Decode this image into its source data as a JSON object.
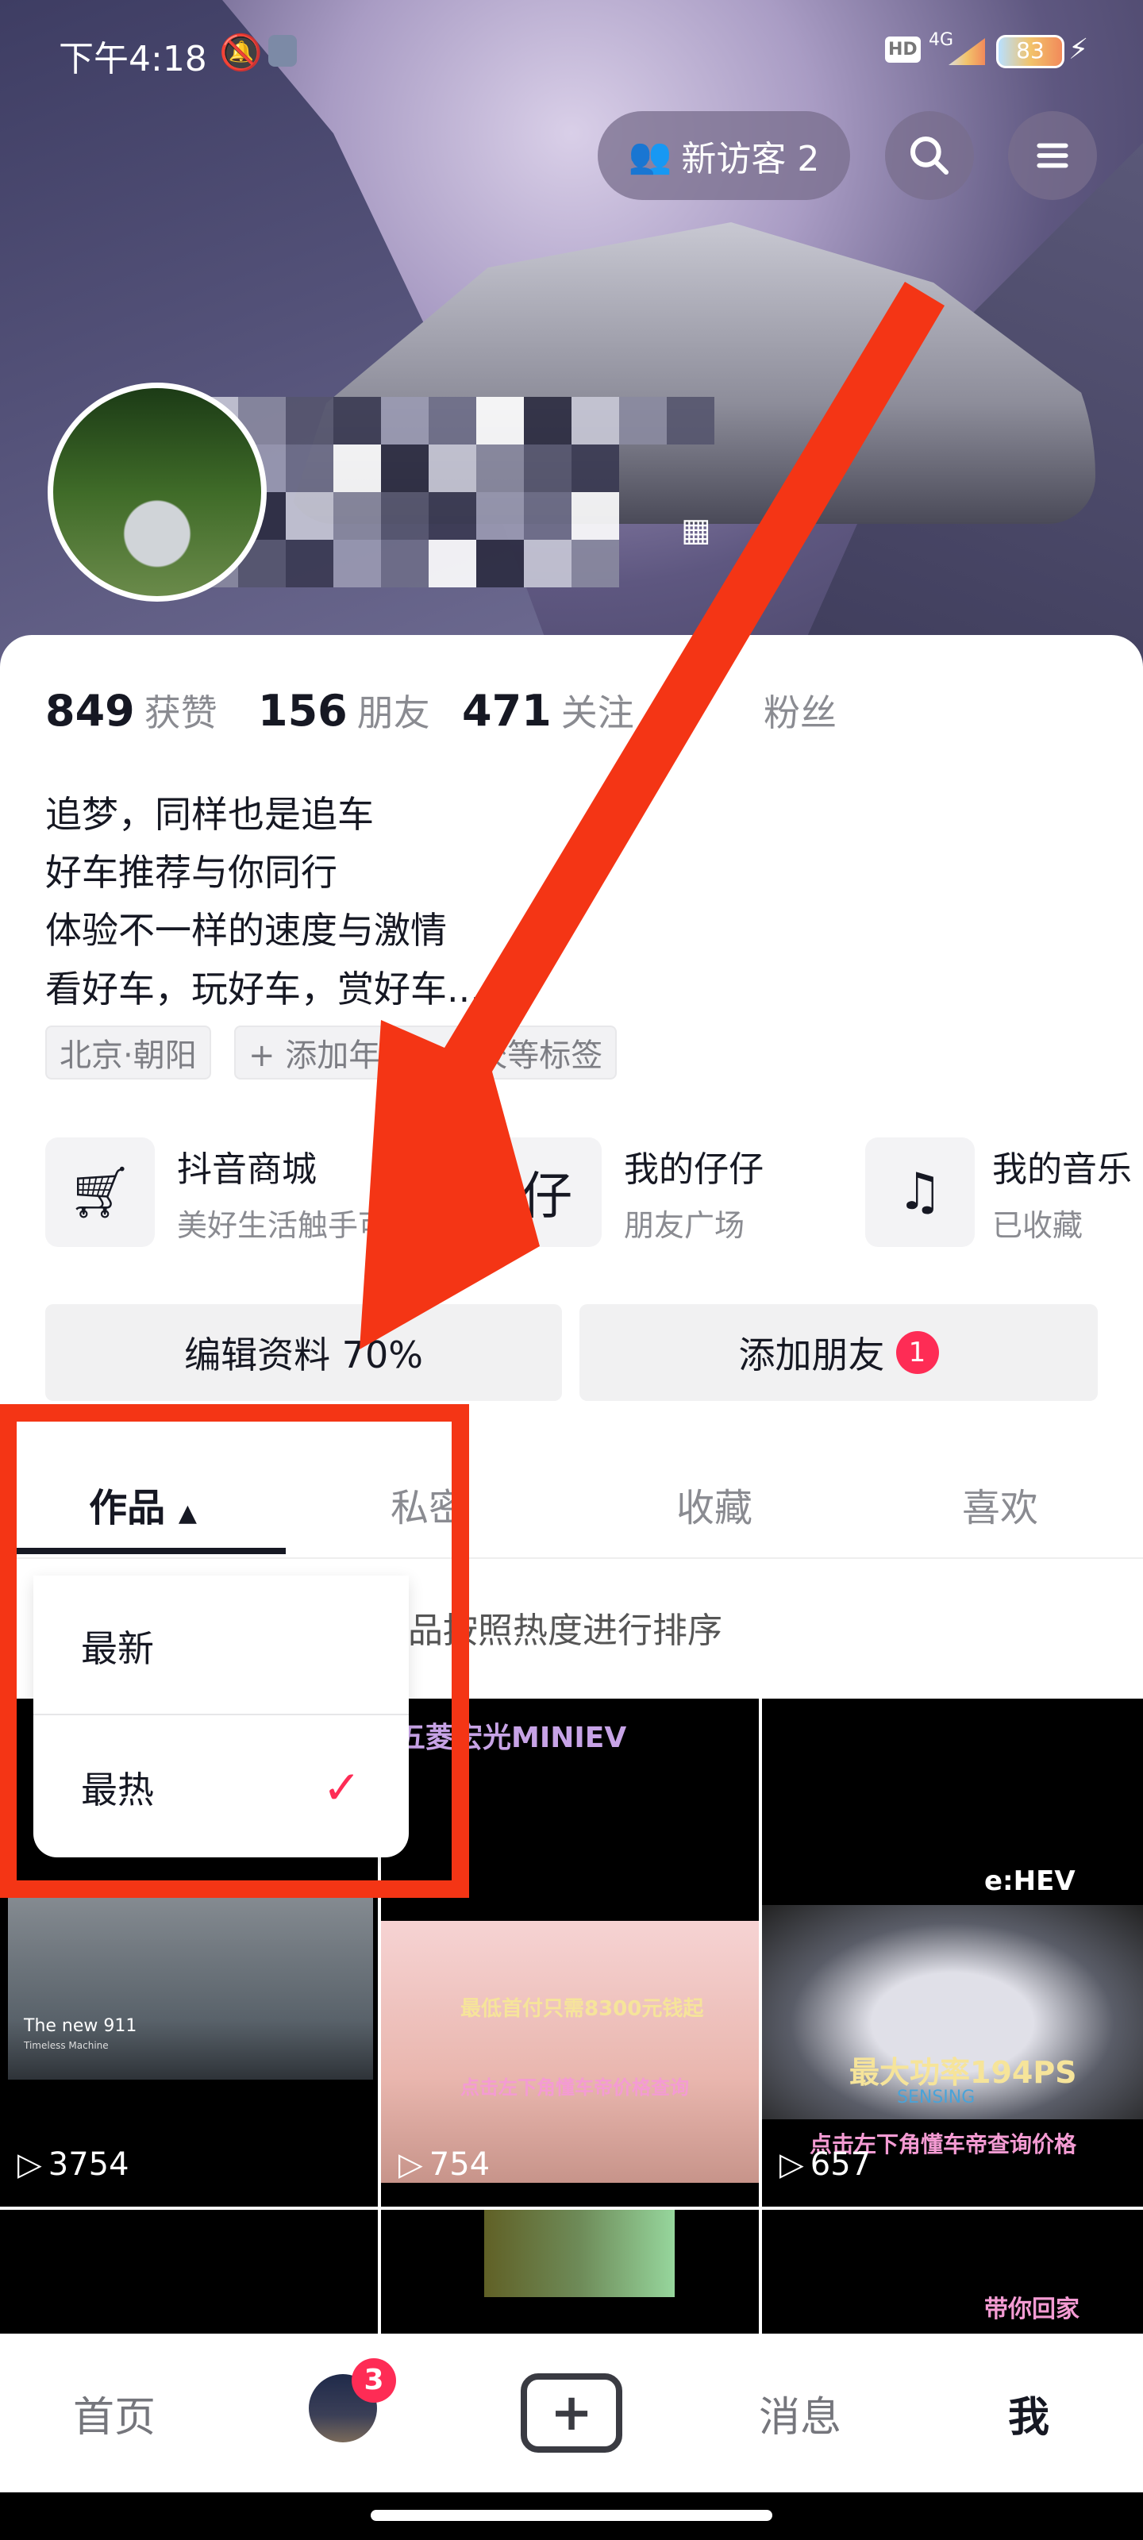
{
  "status_bar": {
    "time": "下午4:18",
    "network": "4G",
    "hd": "HD",
    "battery": "83"
  },
  "header": {
    "visitors_label": "新访客 2",
    "search_icon": "search-icon",
    "menu_icon": "menu-icon"
  },
  "stats": [
    {
      "value": "849",
      "label": "获赞"
    },
    {
      "value": "156",
      "label": "朋友"
    },
    {
      "value": "471",
      "label": "关注"
    },
    {
      "value": "",
      "label": "粉丝"
    }
  ],
  "bio": [
    "追梦，同样也是追车",
    "好车推荐与你同行",
    "体验不一样的速度与激情",
    "看好车，玩好车，赏好车..."
  ],
  "tags": [
    "北京·朝阳",
    "+ 添加年龄、学校等标签"
  ],
  "services": [
    {
      "title": "抖音商城",
      "subtitle": "美好生活触手可得",
      "icon": "cart-icon"
    },
    {
      "title": "我的仔仔",
      "subtitle": "朋友广场",
      "icon": "zaizai-icon"
    },
    {
      "title": "我的音乐",
      "subtitle": "已收藏",
      "icon": "music-icon"
    }
  ],
  "buttons": {
    "edit_profile": "编辑资料 70%",
    "add_friends": "添加朋友",
    "add_friends_badge": "1"
  },
  "tabs": [
    "作品",
    "私密",
    "收藏",
    "喜欢"
  ],
  "sort_hint": "作品按照热度进行排序",
  "sort_menu": {
    "items": [
      "最新",
      "最热"
    ],
    "selected": "最热"
  },
  "videos": [
    {
      "plays": "3754",
      "caption": "The new 911",
      "subcaption": "Timeless Machine"
    },
    {
      "plays": "754",
      "caption": "最低首付只需8300元钱起",
      "overlay": "点击左下角懂车帝价格查询",
      "title": "五菱宏光MINIEV"
    },
    {
      "plays": "657",
      "caption": "最大功率194PS",
      "overlay": "点击左下角懂车帝查询价格",
      "badge": "e:HEV",
      "sub": "SENSING"
    },
    {
      "caption": "带你回家"
    }
  ],
  "bottom_nav": {
    "items": [
      "首页",
      "",
      "",
      "消息",
      "我"
    ],
    "badge": "3",
    "active": "我"
  },
  "colors": {
    "accent": "#fe2c55",
    "annotation": "#f43515",
    "check": "#fe2c55"
  }
}
